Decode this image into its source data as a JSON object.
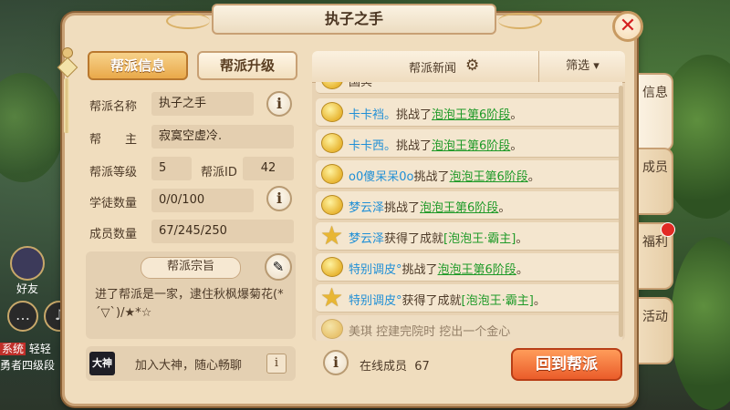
{
  "window": {
    "title": "执子之手"
  },
  "tabs": {
    "info": "帮派信息",
    "upgrade": "帮派升级"
  },
  "info": {
    "name_label": "帮派名称",
    "name_value": "执子之手",
    "leader_label": "帮　　主",
    "leader_value": "寂寞空虚冷.",
    "level_label": "帮派等级",
    "level_value": "5",
    "id_label": "帮派ID",
    "id_value": "42",
    "apprentice_label": "学徒数量",
    "apprentice_value": "0/0/100",
    "member_label": "成员数量",
    "member_value": "67/245/250"
  },
  "motto": {
    "title": "帮派宗旨",
    "text": "进了帮派是一家，逮住秋枫爆菊花(*´▽`)/★*☆"
  },
  "dashen": {
    "logo": "大神",
    "text": "加入大神，随心畅聊"
  },
  "news": {
    "title": "帮派新闻",
    "filter": "筛选 ▾",
    "top_partial": "国冥",
    "items": [
      {
        "name": "卡卡裆。",
        "verb": "挑战了",
        "target": "泡泡王第6阶段",
        "end": "。",
        "icon": "face"
      },
      {
        "name": "卡卡西。",
        "verb": "挑战了",
        "target": "泡泡王第6阶段",
        "end": "。",
        "icon": "face"
      },
      {
        "name": "o0傻呆呆0o",
        "verb": "挑战了",
        "target": "泡泡王第6阶段",
        "end": "。",
        "icon": "face"
      },
      {
        "name": "梦云泽",
        "verb": "挑战了",
        "target": "泡泡王第6阶段",
        "end": "。",
        "icon": "face"
      },
      {
        "name": "梦云泽",
        "verb": "获得了成就",
        "target": "[泡泡王·霸主]",
        "end": "。",
        "icon": "star"
      },
      {
        "name": "特别调皮°",
        "verb": "挑战了",
        "target": "泡泡王第6阶段",
        "end": "。",
        "icon": "face"
      },
      {
        "name": "特别调皮°",
        "verb": "获得了成就",
        "target": "[泡泡王·霸主]",
        "end": "。",
        "icon": "star"
      }
    ],
    "bottom_partial": "美琪 控建完院时 挖出一个金心"
  },
  "online": {
    "label": "在线成员",
    "count": "67"
  },
  "back_button": "回到帮派",
  "side_tabs": [
    "信息",
    "成员",
    "福利",
    "活动"
  ],
  "bg_ui": {
    "friend": "好友",
    "sys_tag": "系统",
    "sys_text": "轻轻",
    "sys_line2": "勇者四级段"
  }
}
